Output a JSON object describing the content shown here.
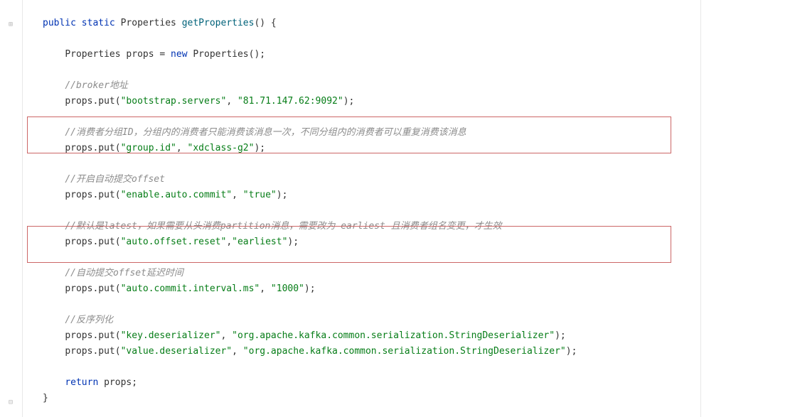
{
  "code": {
    "kw_public": "public",
    "kw_static": "static",
    "kw_new": "new",
    "kw_return": "return",
    "type_properties": "Properties",
    "method_name": "getProperties",
    "var_props": "props",
    "method_put": "put",
    "cmt_broker": "//broker地址",
    "str_bootstrap_k": "\"bootstrap.servers\"",
    "str_bootstrap_v": "\"81.71.147.62:9092\"",
    "cmt_group": "//消费者分组ID，分组内的消费者只能消费该消息一次，不同分组内的消费者可以重复消费该消息",
    "str_group_k": "\"group.id\"",
    "str_group_v": "\"xdclass-g2\"",
    "cmt_autocommit": "//开启自动提交offset",
    "str_autocommit_k": "\"enable.auto.commit\"",
    "str_autocommit_v": "\"true\"",
    "cmt_offsetreset": "//默认是latest，如果需要从头消费partition消息，需要改为 earliest 且消费者组名变更，才生效",
    "str_offsetreset_k": "\"auto.offset.reset\"",
    "str_offsetreset_v": "\"earliest\"",
    "cmt_interval": "//自动提交offset延迟时间",
    "str_interval_k": "\"auto.commit.interval.ms\"",
    "str_interval_v": "\"1000\"",
    "cmt_deser": "//反序列化",
    "str_keyd_k": "\"key.deserializer\"",
    "str_keyd_v": "\"org.apache.kafka.common.serialization.StringDeserializer\"",
    "str_vald_k": "\"value.deserializer\"",
    "str_vald_v": "\"org.apache.kafka.common.serialization.StringDeserializer\""
  },
  "gutter": {
    "top_icon": "⊞",
    "bottom_icon": "⊟"
  }
}
